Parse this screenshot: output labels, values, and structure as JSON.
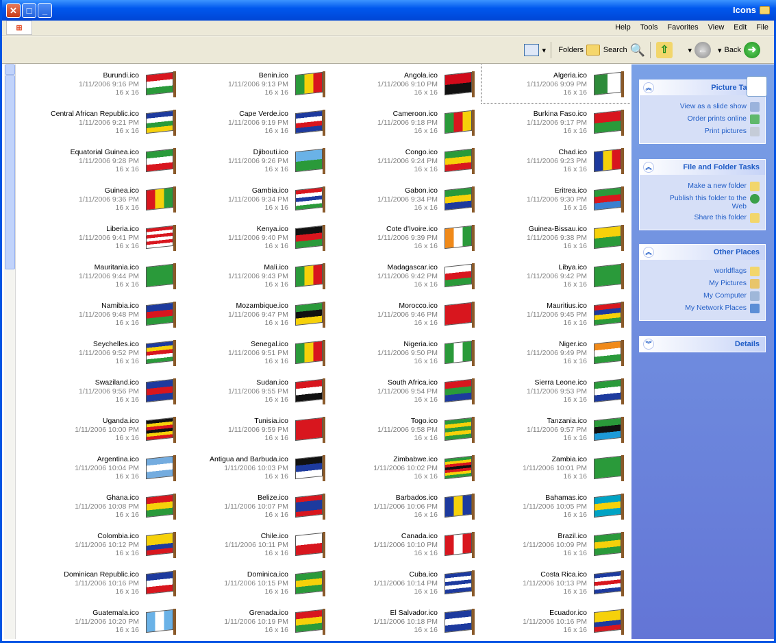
{
  "window": {
    "title": "Icons"
  },
  "menu": [
    "File",
    "Edit",
    "View",
    "Favorites",
    "Tools",
    "Help"
  ],
  "toolbar": {
    "back": "Back",
    "search": "Search",
    "folders": "Folders"
  },
  "sidebar": {
    "picture_tasks": {
      "title": "Picture Tasks",
      "items": [
        "View as a slide show",
        "Order prints online",
        "Print pictures"
      ]
    },
    "file_tasks": {
      "title": "File and Folder Tasks",
      "items": [
        "Make a new folder",
        "Publish this folder to the Web",
        "Share this folder"
      ]
    },
    "other_places": {
      "title": "Other Places",
      "items": [
        "worldflags",
        "My Pictures",
        "My Computer",
        "My Network Places"
      ]
    },
    "details": {
      "title": "Details"
    }
  },
  "colors": {
    "accent": "#0054e3",
    "sidebar": "#6f8edf",
    "link": "#215dc6"
  },
  "files": [
    {
      "name": "Algeria.ico",
      "date": "1/11/2006 9:09 PM",
      "size": "16 x 16",
      "c": [
        "#2e8b3a",
        "#ffffff"
      ],
      "dir": "v"
    },
    {
      "name": "Angola.ico",
      "date": "1/11/2006 9:10 PM",
      "size": "16 x 16",
      "c": [
        "#d10a1a",
        "#111111"
      ],
      "dir": "h"
    },
    {
      "name": "Benin.ico",
      "date": "1/11/2006 9:13 PM",
      "size": "16 x 16",
      "c": [
        "#2a9a3a",
        "#f6d10a",
        "#d8161e"
      ],
      "dir": "v"
    },
    {
      "name": "Burundi.ico",
      "date": "1/11/2006 9:16 PM",
      "size": "16 x 16",
      "c": [
        "#d8161e",
        "#ffffff",
        "#2a9a3a"
      ],
      "dir": "h"
    },
    {
      "name": "Burkina Faso.ico",
      "date": "1/11/2006 9:17 PM",
      "size": "16 x 16",
      "c": [
        "#d8161e",
        "#2a9a3a"
      ],
      "dir": "h"
    },
    {
      "name": "Cameroon.ico",
      "date": "1/11/2006 9:18 PM",
      "size": "16 x 16",
      "c": [
        "#2a9a3a",
        "#d8161e",
        "#f6d10a"
      ],
      "dir": "v"
    },
    {
      "name": "Cape Verde.ico",
      "date": "1/11/2006 9:19 PM",
      "size": "16 x 16",
      "c": [
        "#1d3a9e",
        "#ffffff",
        "#d8161e",
        "#1d3a9e"
      ],
      "dir": "h"
    },
    {
      "name": "Central African Republic.ico",
      "date": "1/11/2006 9:21 PM",
      "size": "16 x 16",
      "c": [
        "#1d3a9e",
        "#ffffff",
        "#2a9a3a",
        "#f6d10a"
      ],
      "dir": "h"
    },
    {
      "name": "Chad.ico",
      "date": "1/11/2006 9:23 PM",
      "size": "16 x 16",
      "c": [
        "#1d3a9e",
        "#f6d10a",
        "#d8161e"
      ],
      "dir": "v"
    },
    {
      "name": "Congo.ico",
      "date": "1/11/2006 9:24 PM",
      "size": "16 x 16",
      "c": [
        "#2a9a3a",
        "#f6d10a",
        "#d8161e"
      ],
      "dir": "h"
    },
    {
      "name": "Djibouti.ico",
      "date": "1/11/2006 9:26 PM",
      "size": "16 x 16",
      "c": [
        "#6ab2e7",
        "#2a9a3a"
      ],
      "dir": "h"
    },
    {
      "name": "Equatorial Guinea.ico",
      "date": "1/11/2006 9:28 PM",
      "size": "16 x 16",
      "c": [
        "#2a9a3a",
        "#ffffff",
        "#d8161e"
      ],
      "dir": "h"
    },
    {
      "name": "Eritrea.ico",
      "date": "1/11/2006 9:30 PM",
      "size": "16 x 16",
      "c": [
        "#2a9a3a",
        "#d8161e",
        "#3a80d0"
      ],
      "dir": "h"
    },
    {
      "name": "Gabon.ico",
      "date": "1/11/2006 9:34 PM",
      "size": "16 x 16",
      "c": [
        "#2a9a3a",
        "#f6d10a",
        "#1d3a9e"
      ],
      "dir": "h"
    },
    {
      "name": "Gambia.ico",
      "date": "1/11/2006 9:34 PM",
      "size": "16 x 16",
      "c": [
        "#d8161e",
        "#ffffff",
        "#1d3a9e",
        "#ffffff",
        "#2a9a3a"
      ],
      "dir": "h"
    },
    {
      "name": "Guinea.ico",
      "date": "1/11/2006 9:36 PM",
      "size": "16 x 16",
      "c": [
        "#d8161e",
        "#f6d10a",
        "#2a9a3a"
      ],
      "dir": "v"
    },
    {
      "name": "Guinea-Bissau.ico",
      "date": "1/11/2006 9:38 PM",
      "size": "16 x 16",
      "c": [
        "#f6d10a",
        "#2a9a3a"
      ],
      "dir": "h"
    },
    {
      "name": "Cote d'Ivoire.ico",
      "date": "1/11/2006 9:39 PM",
      "size": "16 x 16",
      "c": [
        "#f08a1a",
        "#ffffff",
        "#2a9a3a"
      ],
      "dir": "v"
    },
    {
      "name": "Kenya.ico",
      "date": "1/11/2006 9:40 PM",
      "size": "16 x 16",
      "c": [
        "#111111",
        "#d8161e",
        "#2a9a3a"
      ],
      "dir": "h"
    },
    {
      "name": "Liberia.ico",
      "date": "1/11/2006 9:41 PM",
      "size": "16 x 16",
      "c": [
        "#d8161e",
        "#ffffff",
        "#d8161e",
        "#ffffff",
        "#d8161e",
        "#ffffff"
      ],
      "dir": "h"
    },
    {
      "name": "Libya.ico",
      "date": "1/11/2006 9:42 PM",
      "size": "16 x 16",
      "c": [
        "#2a9a3a"
      ],
      "dir": "h"
    },
    {
      "name": "Madagascar.ico",
      "date": "1/11/2006 9:42 PM",
      "size": "16 x 16",
      "c": [
        "#ffffff",
        "#d8161e",
        "#2a9a3a"
      ],
      "dir": "h"
    },
    {
      "name": "Mali.ico",
      "date": "1/11/2006 9:43 PM",
      "size": "16 x 16",
      "c": [
        "#2a9a3a",
        "#f6d10a",
        "#d8161e"
      ],
      "dir": "v"
    },
    {
      "name": "Mauritania.ico",
      "date": "1/11/2006 9:44 PM",
      "size": "16 x 16",
      "c": [
        "#2a9a3a"
      ],
      "dir": "h"
    },
    {
      "name": "Mauritius.ico",
      "date": "1/11/2006 9:45 PM",
      "size": "16 x 16",
      "c": [
        "#d8161e",
        "#1d3a9e",
        "#f6d10a",
        "#2a9a3a"
      ],
      "dir": "h"
    },
    {
      "name": "Morocco.ico",
      "date": "1/11/2006 9:46 PM",
      "size": "16 x 16",
      "c": [
        "#d8161e"
      ],
      "dir": "h"
    },
    {
      "name": "Mozambique.ico",
      "date": "1/11/2006 9:47 PM",
      "size": "16 x 16",
      "c": [
        "#2a9a3a",
        "#111111",
        "#f6d10a"
      ],
      "dir": "h"
    },
    {
      "name": "Namibia.ico",
      "date": "1/11/2006 9:48 PM",
      "size": "16 x 16",
      "c": [
        "#1d3a9e",
        "#d8161e",
        "#2a9a3a"
      ],
      "dir": "h"
    },
    {
      "name": "Niger.ico",
      "date": "1/11/2006 9:49 PM",
      "size": "16 x 16",
      "c": [
        "#f08a1a",
        "#ffffff",
        "#2a9a3a"
      ],
      "dir": "h"
    },
    {
      "name": "Nigeria.ico",
      "date": "1/11/2006 9:50 PM",
      "size": "16 x 16",
      "c": [
        "#2a9a3a",
        "#ffffff",
        "#2a9a3a"
      ],
      "dir": "v"
    },
    {
      "name": "Senegal.ico",
      "date": "1/11/2006 9:51 PM",
      "size": "16 x 16",
      "c": [
        "#2a9a3a",
        "#f6d10a",
        "#d8161e"
      ],
      "dir": "v"
    },
    {
      "name": "Seychelles.ico",
      "date": "1/11/2006 9:52 PM",
      "size": "16 x 16",
      "c": [
        "#1d3a9e",
        "#f6d10a",
        "#d8161e",
        "#ffffff",
        "#2a9a3a"
      ],
      "dir": "h"
    },
    {
      "name": "Sierra Leone.ico",
      "date": "1/11/2006 9:53 PM",
      "size": "16 x 16",
      "c": [
        "#2a9a3a",
        "#ffffff",
        "#1d3a9e"
      ],
      "dir": "h"
    },
    {
      "name": "South Africa.ico",
      "date": "1/11/2006 9:54 PM",
      "size": "16 x 16",
      "c": [
        "#d8161e",
        "#2a9a3a",
        "#1d3a9e"
      ],
      "dir": "h"
    },
    {
      "name": "Sudan.ico",
      "date": "1/11/2006 9:55 PM",
      "size": "16 x 16",
      "c": [
        "#d8161e",
        "#ffffff",
        "#111111"
      ],
      "dir": "h"
    },
    {
      "name": "Swaziland.ico",
      "date": "1/11/2006 9:56 PM",
      "size": "16 x 16",
      "c": [
        "#1d3a9e",
        "#d8161e",
        "#1d3a9e"
      ],
      "dir": "h"
    },
    {
      "name": "Tanzania.ico",
      "date": "1/11/2006 9:57 PM",
      "size": "16 x 16",
      "c": [
        "#2a9a3a",
        "#111111",
        "#1d9ad8"
      ],
      "dir": "h"
    },
    {
      "name": "Togo.ico",
      "date": "1/11/2006 9:58 PM",
      "size": "16 x 16",
      "c": [
        "#2a9a3a",
        "#f6d10a",
        "#2a9a3a",
        "#f6d10a",
        "#2a9a3a"
      ],
      "dir": "h"
    },
    {
      "name": "Tunisia.ico",
      "date": "1/11/2006 9:59 PM",
      "size": "16 x 16",
      "c": [
        "#d8161e"
      ],
      "dir": "h"
    },
    {
      "name": "Uganda.ico",
      "date": "1/11/2006 10:00 PM",
      "size": "16 x 16",
      "c": [
        "#111111",
        "#f6d10a",
        "#d8161e",
        "#111111",
        "#f6d10a",
        "#d8161e"
      ],
      "dir": "h"
    },
    {
      "name": "Zambia.ico",
      "date": "1/11/2006 10:01 PM",
      "size": "16 x 16",
      "c": [
        "#2a9a3a"
      ],
      "dir": "h"
    },
    {
      "name": "Zimbabwe.ico",
      "date": "1/11/2006 10:02 PM",
      "size": "16 x 16",
      "c": [
        "#2a9a3a",
        "#f6d10a",
        "#d8161e",
        "#111111",
        "#d8161e",
        "#f6d10a",
        "#2a9a3a"
      ],
      "dir": "h"
    },
    {
      "name": "Antigua and Barbuda.ico",
      "date": "1/11/2006 10:03 PM",
      "size": "16 x 16",
      "c": [
        "#111111",
        "#1d3a9e",
        "#ffffff"
      ],
      "dir": "h"
    },
    {
      "name": "Argentina.ico",
      "date": "1/11/2006 10:04 PM",
      "size": "16 x 16",
      "c": [
        "#74acdf",
        "#ffffff",
        "#74acdf"
      ],
      "dir": "h"
    },
    {
      "name": "Bahamas.ico",
      "date": "1/11/2006 10:05 PM",
      "size": "16 x 16",
      "c": [
        "#00a3c4",
        "#f6d10a",
        "#00a3c4"
      ],
      "dir": "h"
    },
    {
      "name": "Barbados.ico",
      "date": "1/11/2006 10:06 PM",
      "size": "16 x 16",
      "c": [
        "#1d3a9e",
        "#f6d10a",
        "#1d3a9e"
      ],
      "dir": "v"
    },
    {
      "name": "Belize.ico",
      "date": "1/11/2006 10:07 PM",
      "size": "16 x 16",
      "c": [
        "#d8161e",
        "#1d3a9e",
        "#1d3a9e",
        "#d8161e"
      ],
      "dir": "h"
    },
    {
      "name": "Ghana.ico",
      "date": "1/11/2006 10:08 PM",
      "size": "16 x 16",
      "c": [
        "#d8161e",
        "#f6d10a",
        "#2a9a3a"
      ],
      "dir": "h"
    },
    {
      "name": "Brazil.ico",
      "date": "1/11/2006 10:09 PM",
      "size": "16 x 16",
      "c": [
        "#2a9a3a",
        "#f6d10a",
        "#2a9a3a"
      ],
      "dir": "h"
    },
    {
      "name": "Canada.ico",
      "date": "1/11/2006 10:10 PM",
      "size": "16 x 16",
      "c": [
        "#d8161e",
        "#ffffff",
        "#d8161e"
      ],
      "dir": "v"
    },
    {
      "name": "Chile.ico",
      "date": "1/11/2006 10:11 PM",
      "size": "16 x 16",
      "c": [
        "#ffffff",
        "#d8161e"
      ],
      "dir": "h"
    },
    {
      "name": "Colombia.ico",
      "date": "1/11/2006 10:12 PM",
      "size": "16 x 16",
      "c": [
        "#f6d10a",
        "#f6d10a",
        "#1d3a9e",
        "#d8161e"
      ],
      "dir": "h"
    },
    {
      "name": "Costa Rica.ico",
      "date": "1/11/2006 10:13 PM",
      "size": "16 x 16",
      "c": [
        "#1d3a9e",
        "#ffffff",
        "#d8161e",
        "#ffffff",
        "#1d3a9e"
      ],
      "dir": "h"
    },
    {
      "name": "Cuba.ico",
      "date": "1/11/2006 10:14 PM",
      "size": "16 x 16",
      "c": [
        "#1d3a9e",
        "#ffffff",
        "#1d3a9e",
        "#ffffff",
        "#1d3a9e"
      ],
      "dir": "h"
    },
    {
      "name": "Dominica.ico",
      "date": "1/11/2006 10:15 PM",
      "size": "16 x 16",
      "c": [
        "#2a9a3a",
        "#f6d10a",
        "#2a9a3a"
      ],
      "dir": "h"
    },
    {
      "name": "Dominican Republic.ico",
      "date": "1/11/2006 10:16 PM",
      "size": "16 x 16",
      "c": [
        "#1d3a9e",
        "#ffffff",
        "#d8161e"
      ],
      "dir": "h"
    },
    {
      "name": "Ecuador.ico",
      "date": "1/11/2006 10:16 PM",
      "size": "16 x 16",
      "c": [
        "#f6d10a",
        "#f6d10a",
        "#1d3a9e",
        "#d8161e"
      ],
      "dir": "h"
    },
    {
      "name": "El Salvador.ico",
      "date": "1/11/2006 10:18 PM",
      "size": "16 x 16",
      "c": [
        "#1d3a9e",
        "#ffffff",
        "#1d3a9e"
      ],
      "dir": "h"
    },
    {
      "name": "Grenada.ico",
      "date": "1/11/2006 10:19 PM",
      "size": "16 x 16",
      "c": [
        "#d8161e",
        "#f6d10a",
        "#2a9a3a"
      ],
      "dir": "h"
    },
    {
      "name": "Guatemala.ico",
      "date": "1/11/2006 10:20 PM",
      "size": "16 x 16",
      "c": [
        "#6ab2e7",
        "#ffffff",
        "#6ab2e7"
      ],
      "dir": "v"
    }
  ]
}
